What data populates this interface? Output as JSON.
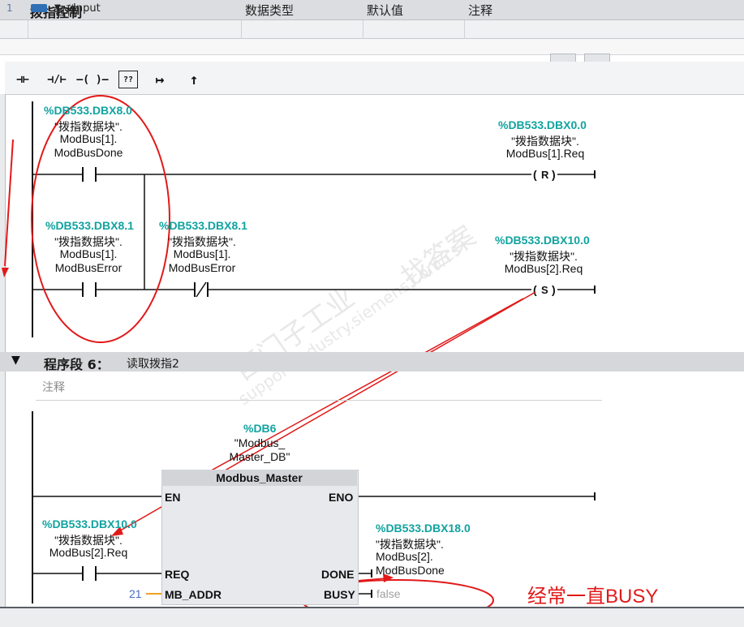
{
  "header": {
    "title": "拨指控制"
  },
  "interface": {
    "columns": [
      "名称",
      "数据类型",
      "默认值",
      "注释"
    ],
    "row": {
      "index": "1",
      "name": "Input"
    }
  },
  "toolbar": {
    "buttons": [
      {
        "icon": "no-contact-icon",
        "glyph": "⊣⊢"
      },
      {
        "icon": "nc-contact-icon",
        "glyph": "⊣/⊢"
      },
      {
        "icon": "coil-icon",
        "glyph": "–( )–"
      },
      {
        "icon": "empty-box-icon",
        "glyph": "??"
      },
      {
        "icon": "open-branch-icon",
        "glyph": "↦"
      },
      {
        "icon": "close-branch-icon",
        "glyph": "↑"
      }
    ]
  },
  "network5": {
    "c1": {
      "addr": "%DB533.DBX8.0",
      "l1": "\"拨指数据块\".",
      "l2": "ModBus[1].",
      "l3": "ModBusDone"
    },
    "r1": {
      "addr": "%DB533.DBX0.0",
      "l1": "\"拨指数据块\".",
      "l2": "ModBus[1].Req",
      "coil": "R"
    },
    "c2": {
      "addr": "%DB533.DBX8.1",
      "l1": "\"拨指数据块\".",
      "l2": "ModBus[1].",
      "l3": "ModBusError"
    },
    "c3": {
      "addr": "%DB533.DBX8.1",
      "l1": "\"拨指数据块\".",
      "l2": "ModBus[1].",
      "l3": "ModBusError"
    },
    "s1": {
      "addr": "%DB533.DBX10.0",
      "l1": "\"拨指数据块\".",
      "l2": "ModBus[2].Req",
      "coil": "S"
    }
  },
  "network6": {
    "label": "程序段 6：",
    "name": "读取拨指2",
    "comment": "注释",
    "db": {
      "addr": "%DB6",
      "l1": "\"Modbus_",
      "l2": "Master_DB\""
    },
    "block": {
      "title": "Modbus_Master",
      "en": "EN",
      "eno": "ENO",
      "req": "REQ",
      "done": "DONE",
      "mb_addr": "MB_ADDR",
      "busy": "BUSY"
    },
    "req_in": {
      "addr": "%DB533.DBX10.0",
      "l1": "\"拨指数据块\".",
      "l2": "ModBus[2].Req"
    },
    "done_out": {
      "addr": "%DB533.DBX18.0",
      "l1": "\"拨指数据块\".",
      "l2": "ModBus[2].",
      "l3": "ModBusDone"
    },
    "mb_addr_value": "21",
    "busy_value": "false"
  },
  "annotation": {
    "note": "经常一直BUSY"
  },
  "watermark": {
    "line1": "西门子工业",
    "line2": "support.industry.siemens.com/cs",
    "line3": "找答案"
  },
  "colors": {
    "address": "#11a3a0",
    "annotation": "#e21919",
    "orange": "#f0a020"
  }
}
